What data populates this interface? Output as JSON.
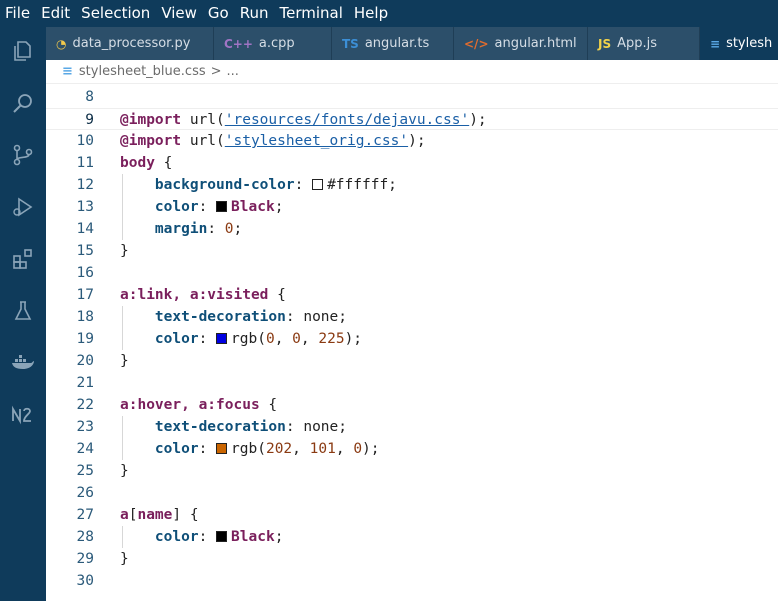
{
  "menu": [
    "File",
    "Edit",
    "Selection",
    "View",
    "Go",
    "Run",
    "Terminal",
    "Help"
  ],
  "activity_icons": [
    "explorer-icon",
    "search-icon",
    "source-control-icon",
    "run-debug-icon",
    "extensions-icon",
    "testing-icon",
    "docker-icon",
    "notebook-icon"
  ],
  "tabs": [
    {
      "label": "data_processor.py",
      "icon": "python-icon",
      "icon_text": "◔",
      "icon_color": "#f2c94c",
      "active": false,
      "width": 168
    },
    {
      "label": "a.cpp",
      "icon": "cpp-icon",
      "icon_text": "C++",
      "icon_color": "#a074c4",
      "active": false,
      "width": 118
    },
    {
      "label": "angular.ts",
      "icon": "typescript-icon",
      "icon_text": "TS",
      "icon_color": "#3c8fd6",
      "active": false,
      "width": 122
    },
    {
      "label": "angular.html",
      "icon": "html-icon",
      "icon_text": "</>",
      "icon_color": "#e06c2e",
      "active": false,
      "width": 134
    },
    {
      "label": "App.js",
      "icon": "javascript-icon",
      "icon_text": "JS",
      "icon_color": "#f1d24a",
      "active": false,
      "width": 112
    },
    {
      "label": "stylesh",
      "icon": "css-icon",
      "icon_text": "≡",
      "icon_color": "#5aa8e6",
      "active": true,
      "width": 80
    }
  ],
  "breadcrumb": {
    "file": "stylesheet_blue.css",
    "sep": ">",
    "more": "..."
  },
  "colors": {
    "menubar": "#0f3b5b",
    "tabbar": "#2c4f6a",
    "swatch_white": "#ffffff",
    "swatch_black": "#000000",
    "swatch_blue": "#0000e1",
    "swatch_orange": "#ca6500"
  },
  "lines": [
    {
      "n": "8",
      "tokens": []
    },
    {
      "n": "9",
      "current": true,
      "tokens": [
        {
          "t": "kw",
          "v": "@import"
        },
        {
          "t": "plain",
          "v": " url("
        },
        {
          "t": "str",
          "v": "'resources/fonts/dejavu.css'"
        },
        {
          "t": "plain",
          "v": ");"
        }
      ]
    },
    {
      "n": "10",
      "tokens": [
        {
          "t": "kw",
          "v": "@import"
        },
        {
          "t": "plain",
          "v": " url("
        },
        {
          "t": "str",
          "v": "'stylesheet_orig.css'"
        },
        {
          "t": "plain",
          "v": ");"
        }
      ]
    },
    {
      "n": "11",
      "tokens": [
        {
          "t": "sel",
          "v": "body"
        },
        {
          "t": "plain",
          "v": " {"
        }
      ]
    },
    {
      "n": "12",
      "tokens": [
        {
          "t": "plain",
          "v": "    "
        },
        {
          "t": "prop",
          "v": "background-color"
        },
        {
          "t": "plain",
          "v": ": "
        },
        {
          "t": "swatch",
          "v": "#ffffff"
        },
        {
          "t": "plain",
          "v": "#ffffff;"
        }
      ]
    },
    {
      "n": "13",
      "tokens": [
        {
          "t": "plain",
          "v": "    "
        },
        {
          "t": "prop",
          "v": "color"
        },
        {
          "t": "plain",
          "v": ": "
        },
        {
          "t": "swatch",
          "v": "#000000"
        },
        {
          "t": "val",
          "v": "Black"
        },
        {
          "t": "plain",
          "v": ";"
        }
      ]
    },
    {
      "n": "14",
      "tokens": [
        {
          "t": "plain",
          "v": "    "
        },
        {
          "t": "prop",
          "v": "margin"
        },
        {
          "t": "plain",
          "v": ": "
        },
        {
          "t": "num",
          "v": "0"
        },
        {
          "t": "plain",
          "v": ";"
        }
      ]
    },
    {
      "n": "15",
      "tokens": [
        {
          "t": "plain",
          "v": "}"
        }
      ]
    },
    {
      "n": "16",
      "tokens": []
    },
    {
      "n": "17",
      "tokens": [
        {
          "t": "sel",
          "v": "a:link, a:visited"
        },
        {
          "t": "plain",
          "v": " {"
        }
      ]
    },
    {
      "n": "18",
      "tokens": [
        {
          "t": "plain",
          "v": "    "
        },
        {
          "t": "prop",
          "v": "text-decoration"
        },
        {
          "t": "plain",
          "v": ": none;"
        }
      ]
    },
    {
      "n": "19",
      "tokens": [
        {
          "t": "plain",
          "v": "    "
        },
        {
          "t": "prop",
          "v": "color"
        },
        {
          "t": "plain",
          "v": ": "
        },
        {
          "t": "swatch",
          "v": "#0000e1"
        },
        {
          "t": "plain",
          "v": "rgb("
        },
        {
          "t": "num",
          "v": "0"
        },
        {
          "t": "plain",
          "v": ", "
        },
        {
          "t": "num",
          "v": "0"
        },
        {
          "t": "plain",
          "v": ", "
        },
        {
          "t": "num",
          "v": "225"
        },
        {
          "t": "plain",
          "v": ");"
        }
      ]
    },
    {
      "n": "20",
      "tokens": [
        {
          "t": "plain",
          "v": "}"
        }
      ]
    },
    {
      "n": "21",
      "tokens": []
    },
    {
      "n": "22",
      "tokens": [
        {
          "t": "sel",
          "v": "a:hover, a:focus"
        },
        {
          "t": "plain",
          "v": " {"
        }
      ]
    },
    {
      "n": "23",
      "tokens": [
        {
          "t": "plain",
          "v": "    "
        },
        {
          "t": "prop",
          "v": "text-decoration"
        },
        {
          "t": "plain",
          "v": ": none;"
        }
      ]
    },
    {
      "n": "24",
      "tokens": [
        {
          "t": "plain",
          "v": "    "
        },
        {
          "t": "prop",
          "v": "color"
        },
        {
          "t": "plain",
          "v": ": "
        },
        {
          "t": "swatch",
          "v": "#ca6500"
        },
        {
          "t": "plain",
          "v": "rgb("
        },
        {
          "t": "num",
          "v": "202"
        },
        {
          "t": "plain",
          "v": ", "
        },
        {
          "t": "num",
          "v": "101"
        },
        {
          "t": "plain",
          "v": ", "
        },
        {
          "t": "num",
          "v": "0"
        },
        {
          "t": "plain",
          "v": ");"
        }
      ]
    },
    {
      "n": "25",
      "tokens": [
        {
          "t": "plain",
          "v": "}"
        }
      ]
    },
    {
      "n": "26",
      "tokens": []
    },
    {
      "n": "27",
      "tokens": [
        {
          "t": "sel",
          "v": "a"
        },
        {
          "t": "plain",
          "v": "["
        },
        {
          "t": "sel",
          "v": "name"
        },
        {
          "t": "plain",
          "v": "] {"
        }
      ]
    },
    {
      "n": "28",
      "tokens": [
        {
          "t": "plain",
          "v": "    "
        },
        {
          "t": "prop",
          "v": "color"
        },
        {
          "t": "plain",
          "v": ": "
        },
        {
          "t": "swatch",
          "v": "#000000"
        },
        {
          "t": "val",
          "v": "Black"
        },
        {
          "t": "plain",
          "v": ";"
        }
      ]
    },
    {
      "n": "29",
      "tokens": [
        {
          "t": "plain",
          "v": "}"
        }
      ]
    },
    {
      "n": "30",
      "tokens": []
    }
  ]
}
